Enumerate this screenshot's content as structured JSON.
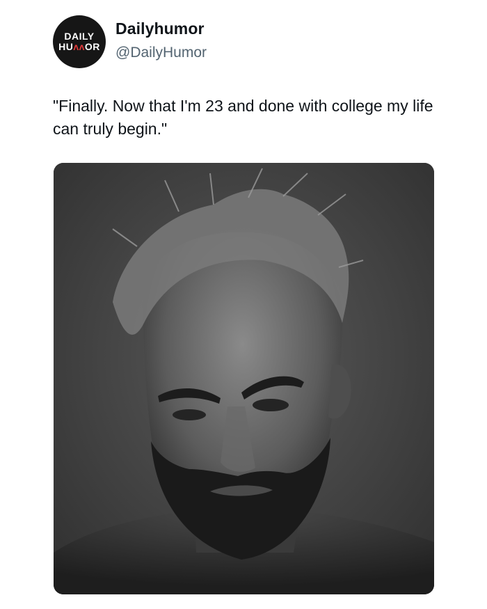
{
  "post": {
    "author": {
      "display_name": "Dailyhumor",
      "handle": "@DailyHumor",
      "avatar_logo": {
        "line1": "DAILY",
        "line2_left": "HU",
        "line2_mid": "ʌʌ",
        "line2_right": "OR"
      }
    },
    "text": "\"Finally. Now that I'm 23 and done with college my life can truly begin.\"",
    "media": {
      "type": "photo",
      "icon": "photo-icon"
    }
  },
  "colors": {
    "text": "#0f1419",
    "secondary_text": "#536471",
    "avatar_bg": "#161616",
    "logo_accent": "#e03a3a"
  }
}
